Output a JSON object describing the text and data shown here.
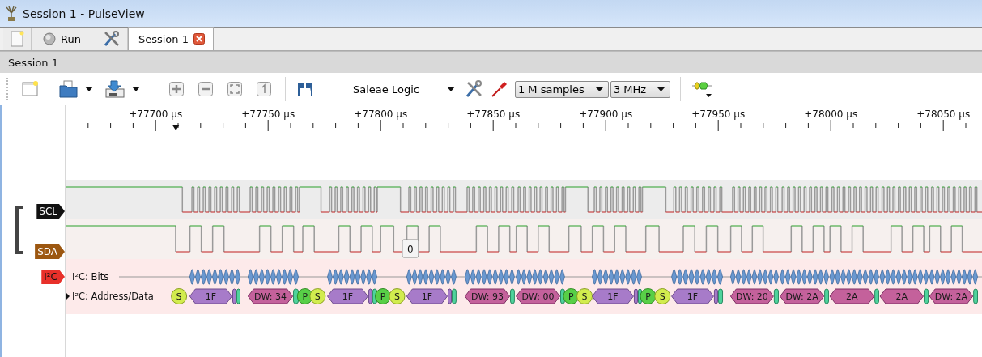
{
  "window": {
    "title": "Session 1 - PulseView"
  },
  "tab_bar": {
    "run_button": {
      "label": "Run"
    },
    "tabs": [
      {
        "label": "Session 1",
        "selected": true
      }
    ]
  },
  "session_header": {
    "title": "Session 1"
  },
  "toolbar": {
    "device": "Saleae Logic",
    "sample_count": "1 M samples",
    "sample_rate": "3 MHz"
  },
  "ruler": {
    "labels": [
      "+77700 µs",
      "+77750 µs",
      "+77800 µs",
      "+77850 µs",
      "+77900 µs",
      "+77950 µs",
      "+78000 µs",
      "+78050 µs"
    ]
  },
  "channels": [
    {
      "name": "SCL",
      "color": "#111111"
    },
    {
      "name": "SDA",
      "color": "#9c5710"
    }
  ],
  "decoder": {
    "name": "I²C",
    "color": "#e8302a",
    "rows": [
      {
        "kind": "bits",
        "label": "I²C: Bits"
      },
      {
        "kind": "annotations",
        "label": "I²C: Address/Data",
        "expanded": false
      }
    ]
  },
  "annotations": [
    {
      "kind": "start",
      "label": "S"
    },
    {
      "kind": "address",
      "label": "1F"
    },
    {
      "kind": "rw"
    },
    {
      "kind": "ack"
    },
    {
      "kind": "data",
      "label": "DW: 34"
    },
    {
      "kind": "ack"
    },
    {
      "kind": "stop",
      "label": "P"
    },
    {
      "kind": "start",
      "label": "S"
    },
    {
      "kind": "address",
      "label": "1F"
    },
    {
      "kind": "rw"
    },
    {
      "kind": "ack"
    },
    {
      "kind": "stop",
      "label": "P"
    },
    {
      "kind": "start",
      "label": "S"
    },
    {
      "kind": "address",
      "label": "1F"
    },
    {
      "kind": "rw"
    },
    {
      "kind": "ack"
    },
    {
      "kind": "data",
      "label": "DW: 93"
    },
    {
      "kind": "ack"
    },
    {
      "kind": "data",
      "label": "DW: 00"
    },
    {
      "kind": "ack"
    },
    {
      "kind": "stop",
      "label": "P"
    },
    {
      "kind": "start",
      "label": "S"
    },
    {
      "kind": "address",
      "label": "1F"
    },
    {
      "kind": "rw"
    },
    {
      "kind": "ack"
    },
    {
      "kind": "stop",
      "label": "P"
    },
    {
      "kind": "start",
      "label": "S"
    },
    {
      "kind": "address",
      "label": "1F"
    },
    {
      "kind": "rw"
    },
    {
      "kind": "ack"
    },
    {
      "kind": "data",
      "label": "DW: 20"
    },
    {
      "kind": "ack"
    },
    {
      "kind": "data",
      "label": "DW: 2A"
    },
    {
      "kind": "ack"
    },
    {
      "kind": "data",
      "label": "2A"
    },
    {
      "kind": "ack"
    },
    {
      "kind": "data",
      "label": "2A"
    },
    {
      "kind": "ack"
    },
    {
      "kind": "data",
      "label": "DW: 2A"
    },
    {
      "kind": "ack"
    }
  ],
  "hover_tooltip": {
    "text": "0"
  }
}
